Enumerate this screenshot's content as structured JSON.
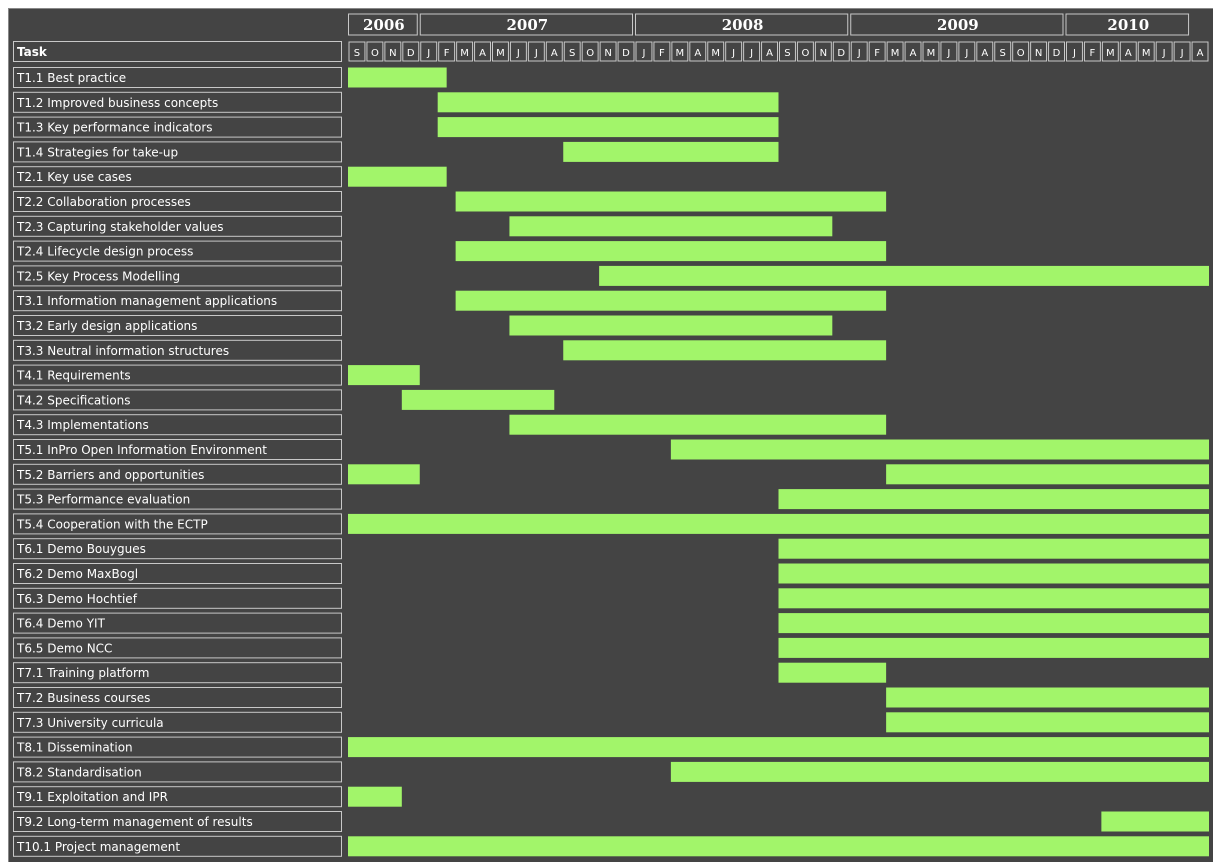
{
  "chart_data": {
    "type": "gantt",
    "header_task_label": "Task",
    "years": [
      {
        "label": "2006",
        "start": 0,
        "end": 4
      },
      {
        "label": "2007",
        "start": 4,
        "end": 16
      },
      {
        "label": "2008",
        "start": 16,
        "end": 28
      },
      {
        "label": "2009",
        "start": 28,
        "end": 40
      },
      {
        "label": "2010",
        "start": 40,
        "end": 47
      }
    ],
    "months": [
      "S",
      "O",
      "N",
      "D",
      "J",
      "F",
      "M",
      "A",
      "M",
      "J",
      "J",
      "A",
      "S",
      "O",
      "N",
      "D",
      "J",
      "F",
      "M",
      "A",
      "M",
      "J",
      "J",
      "A",
      "S",
      "O",
      "N",
      "D",
      "J",
      "F",
      "M",
      "A",
      "M",
      "J",
      "J",
      "A",
      "S",
      "O",
      "N",
      "D",
      "J",
      "F",
      "M",
      "A",
      "M",
      "J",
      "J",
      "A"
    ],
    "tasks": [
      {
        "name": "T1.1 Best practice",
        "bars": [
          [
            0,
            5.5
          ]
        ]
      },
      {
        "name": "T1.2 Improved business concepts",
        "bars": [
          [
            5,
            24
          ]
        ]
      },
      {
        "name": "T1.3 Key performance indicators",
        "bars": [
          [
            5,
            24
          ]
        ]
      },
      {
        "name": "T1.4 Strategies for take-up",
        "bars": [
          [
            12,
            24
          ]
        ]
      },
      {
        "name": "T2.1 Key use cases",
        "bars": [
          [
            0,
            5.5
          ]
        ]
      },
      {
        "name": "T2.2 Collaboration processes",
        "bars": [
          [
            6,
            30
          ]
        ]
      },
      {
        "name": "T2.3 Capturing stakeholder values",
        "bars": [
          [
            9,
            27
          ]
        ]
      },
      {
        "name": "T2.4 Lifecycle design process",
        "bars": [
          [
            6,
            30
          ]
        ]
      },
      {
        "name": "T2.5 Key Process Modelling",
        "bars": [
          [
            14,
            48
          ]
        ]
      },
      {
        "name": "T3.1 Information management applications",
        "bars": [
          [
            6,
            30
          ]
        ]
      },
      {
        "name": "T3.2 Early design applications",
        "bars": [
          [
            9,
            27
          ]
        ]
      },
      {
        "name": "T3.3 Neutral information structures",
        "bars": [
          [
            12,
            30
          ]
        ]
      },
      {
        "name": "T4.1 Requirements",
        "bars": [
          [
            0,
            4
          ]
        ]
      },
      {
        "name": "T4.2 Specifications",
        "bars": [
          [
            3,
            11.5
          ]
        ]
      },
      {
        "name": "T4.3 Implementations",
        "bars": [
          [
            9,
            30
          ]
        ]
      },
      {
        "name": "T5.1 InPro Open Information Environment",
        "bars": [
          [
            18,
            48
          ]
        ]
      },
      {
        "name": "T5.2 Barriers and opportunities",
        "bars": [
          [
            0,
            4
          ],
          [
            30,
            48
          ]
        ]
      },
      {
        "name": "T5.3 Performance evaluation",
        "bars": [
          [
            24,
            48
          ]
        ]
      },
      {
        "name": "T5.4 Cooperation with the ECTP",
        "bars": [
          [
            0,
            48
          ]
        ]
      },
      {
        "name": "T6.1 Demo Bouygues",
        "bars": [
          [
            24,
            48
          ]
        ]
      },
      {
        "name": "T6.2 Demo MaxBogl",
        "bars": [
          [
            24,
            48
          ]
        ]
      },
      {
        "name": "T6.3 Demo Hochtief",
        "bars": [
          [
            24,
            48
          ]
        ]
      },
      {
        "name": "T6.4 Demo YIT",
        "bars": [
          [
            24,
            48
          ]
        ]
      },
      {
        "name": "T6.5 Demo NCC",
        "bars": [
          [
            24,
            48
          ]
        ]
      },
      {
        "name": "T7.1 Training platform",
        "bars": [
          [
            24,
            30
          ]
        ]
      },
      {
        "name": "T7.2 Business courses",
        "bars": [
          [
            30,
            48
          ]
        ]
      },
      {
        "name": "T7.3 University curricula",
        "bars": [
          [
            30,
            48
          ]
        ]
      },
      {
        "name": "T8.1 Dissemination",
        "bars": [
          [
            0,
            48
          ]
        ]
      },
      {
        "name": "T8.2 Standardisation",
        "bars": [
          [
            18,
            48
          ]
        ]
      },
      {
        "name": "T9.1 Exploitation and IPR",
        "bars": [
          [
            0,
            3
          ]
        ]
      },
      {
        "name": "T9.2 Long-term management of results",
        "bars": [
          [
            42,
            48
          ]
        ]
      },
      {
        "name": "T10.1 Project management",
        "bars": [
          [
            0,
            48
          ]
        ]
      }
    ],
    "xlim": [
      0,
      48
    ],
    "colors": {
      "background": "#444444",
      "bar": "#a2f56a",
      "cell_border": "#c8c8c8",
      "text": "#ffffff"
    }
  }
}
